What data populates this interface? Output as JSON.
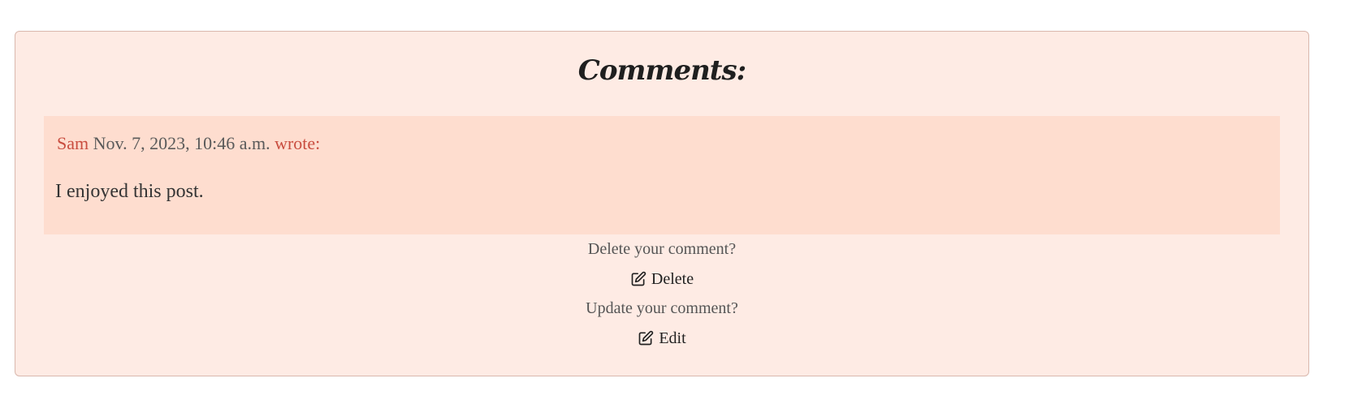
{
  "comments_section": {
    "title": "Comments:",
    "comments": [
      {
        "author": "Sam",
        "date": "Nov. 7, 2023, 10:46 a.m.",
        "wrote_label": "wrote:",
        "body": "I enjoyed this post."
      }
    ],
    "delete_prompt": "Delete your comment?",
    "delete_label": "Delete",
    "update_prompt": "Update your comment?",
    "edit_label": "Edit",
    "icons": {
      "delete": "edit-icon",
      "edit": "edit-icon"
    }
  },
  "colors": {
    "card_background": "#feebe4",
    "comment_background": "#feddcf",
    "accent_text": "#c94d3f"
  }
}
